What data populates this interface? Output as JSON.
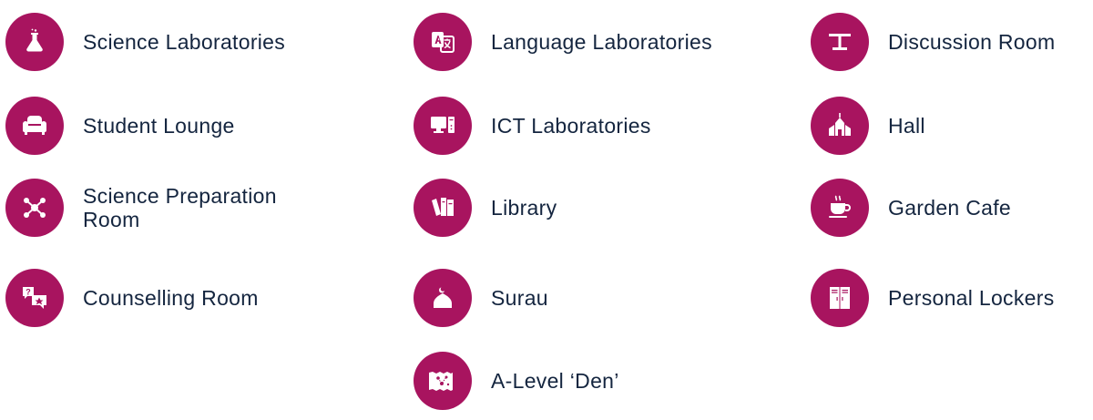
{
  "theme": {
    "accent": "#a8145f",
    "text": "#14253f"
  },
  "facilities": [
    {
      "label": "Science Laboratories",
      "icon": "flask-icon"
    },
    {
      "label": "Language Laboratories",
      "icon": "translate-icon"
    },
    {
      "label": "Discussion Room",
      "icon": "table-icon"
    },
    {
      "label": "Student Lounge",
      "icon": "sofa-icon"
    },
    {
      "label": "ICT Laboratories",
      "icon": "computer-icon"
    },
    {
      "label": "Hall",
      "icon": "building-icon"
    },
    {
      "label": "Science Preparation Room",
      "icon": "molecule-icon"
    },
    {
      "label": "Library",
      "icon": "books-icon"
    },
    {
      "label": "Garden Cafe",
      "icon": "coffee-cup-icon"
    },
    {
      "label": "Counselling Room",
      "icon": "chat-bubbles-icon"
    },
    {
      "label": "Surau",
      "icon": "mosque-dome-icon"
    },
    {
      "label": "Personal Lockers",
      "icon": "locker-icon"
    },
    {
      "label": "A-Level ‘Den’",
      "icon": "map-scroll-icon"
    }
  ]
}
